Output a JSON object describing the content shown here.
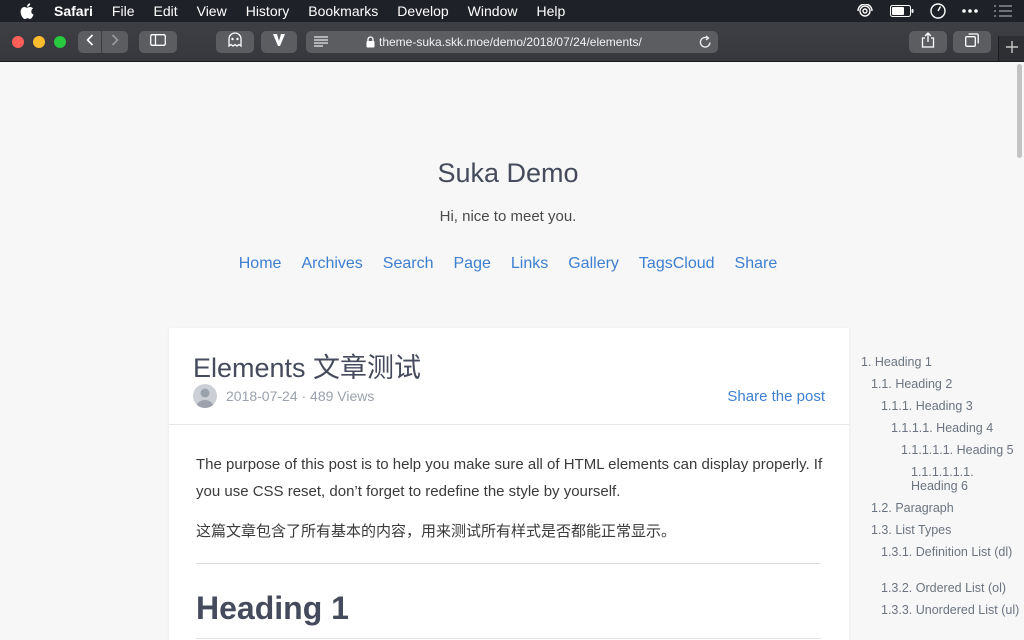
{
  "menubar": {
    "app_name": "Safari",
    "items": [
      "File",
      "Edit",
      "View",
      "History",
      "Bookmarks",
      "Develop",
      "Window",
      "Help"
    ]
  },
  "browser": {
    "url": "theme-suka.skk.moe/demo/2018/07/24/elements/"
  },
  "site": {
    "title": "Suka Demo",
    "description": "Hi, nice to meet you.",
    "nav": [
      "Home",
      "Archives",
      "Search",
      "Page",
      "Links",
      "Gallery",
      "TagsCloud",
      "Share"
    ]
  },
  "post": {
    "title": "Elements 文章测试",
    "meta": "2018-07-24 · 489 Views",
    "share_label": "Share the post",
    "paragraph_en": "The purpose of this post is to help you make sure all of HTML elements can display properly. If you use CSS reset, don’t forget to redefine the style by yourself.",
    "paragraph_zh": "这篇文章包含了所有基本的内容，用来测试所有样式是否都能正常显示。",
    "heading1": "Heading 1"
  },
  "toc": [
    "1. Heading 1",
    "1.1. Heading 2",
    "1.1.1. Heading 3",
    "1.1.1.1. Heading 4",
    "1.1.1.1.1. Heading 5",
    "1.1.1.1.1.1. Heading 6",
    "1.2. Paragraph",
    "1.3. List Types",
    "1.3.1. Definition List (dl)",
    "1.3.2. Ordered List (ol)",
    "1.3.3. Unordered List (ul)"
  ],
  "colors": {
    "link": "#3d7fd1",
    "title": "#454b5c",
    "menubar_bg": "#1f2128",
    "toolbar_bg": "#3d3f44"
  },
  "icons": [
    "apple-icon",
    "wifi-icon",
    "battery-icon",
    "clock-icon",
    "more-icon",
    "list-icon",
    "back-icon",
    "forward-icon",
    "sidebar-icon",
    "extension-ghost-icon",
    "extension-v-icon",
    "reader-icon",
    "lock-icon",
    "reload-icon",
    "share-icon",
    "tabs-icon",
    "plus-icon"
  ]
}
